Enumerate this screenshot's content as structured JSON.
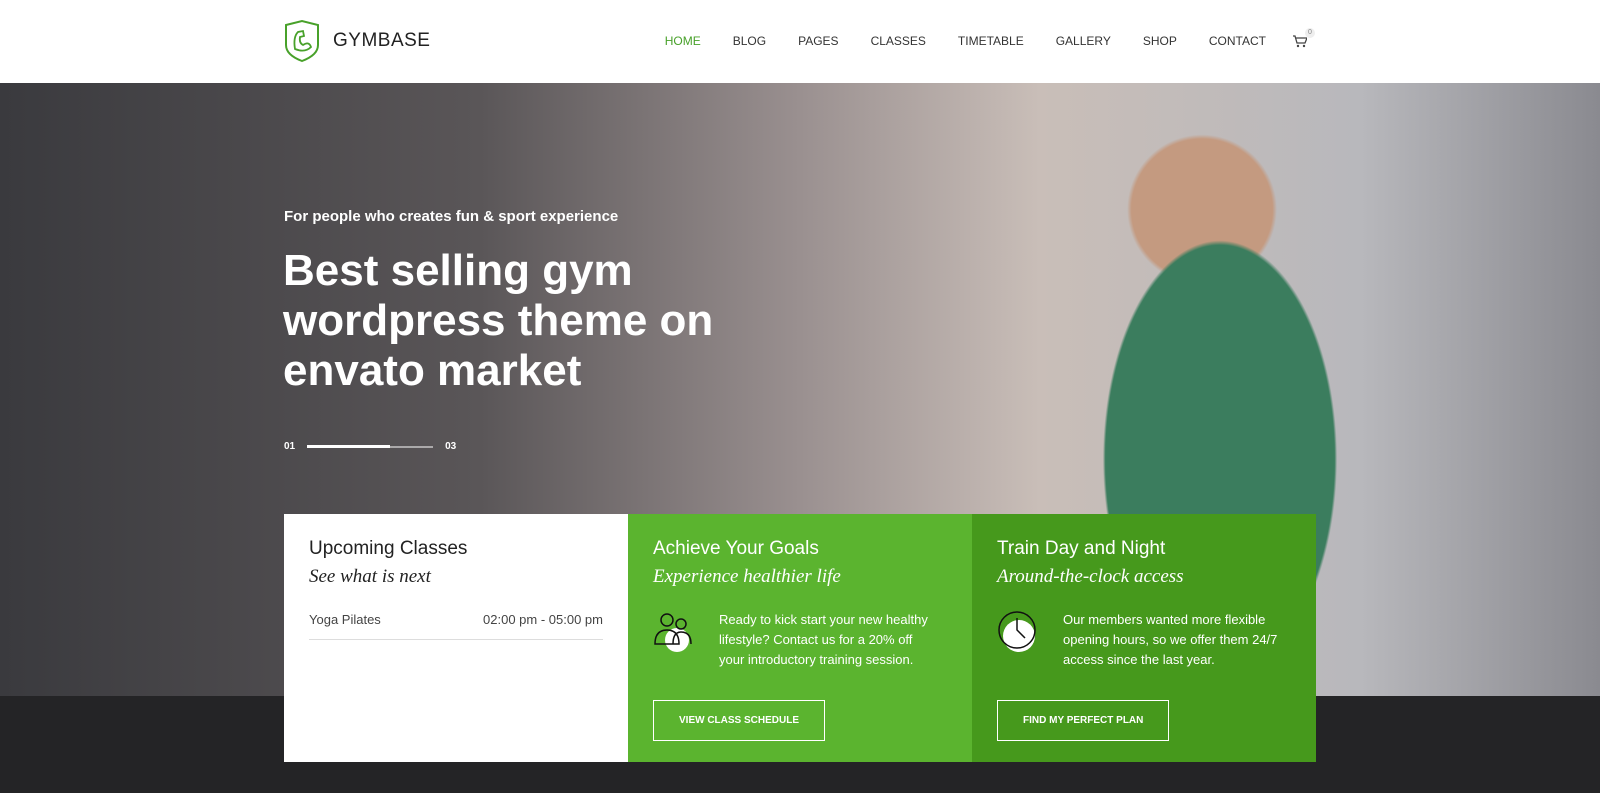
{
  "header": {
    "logo": "GYMBASE",
    "nav": [
      "HOME",
      "BLOG",
      "PAGES",
      "CLASSES",
      "TIMETABLE",
      "GALLERY",
      "SHOP",
      "CONTACT"
    ],
    "cart_count": "0"
  },
  "hero": {
    "subtitle": "For people who creates fun & sport experience",
    "title": "Best selling gym wordpress theme on envato market",
    "slide_current": "01",
    "slide_total": "03",
    "slide_progress": 0.66
  },
  "boxes": [
    {
      "title": "Upcoming Classes",
      "subtitle": "See what is next",
      "class_name": "Yoga Pilates",
      "class_time": "02:00 pm - 05:00 pm"
    },
    {
      "title": "Achieve Your Goals",
      "subtitle": "Experience healthier life",
      "text": "Ready to kick start your new healthy lifestyle? Contact us for a 20% off your introductory training session.",
      "button": "VIEW CLASS SCHEDULE",
      "icon": "people-icon"
    },
    {
      "title": "Train Day and Night",
      "subtitle": "Around-the-clock access",
      "text": "Our members wanted more flexible opening hours, so we offer them 24/7 access since the last year.",
      "button": "FIND MY PERFECT PLAN",
      "icon": "clock-icon"
    }
  ],
  "colors": {
    "accent": "#5bb42f",
    "accent_dark": "#46991c"
  }
}
